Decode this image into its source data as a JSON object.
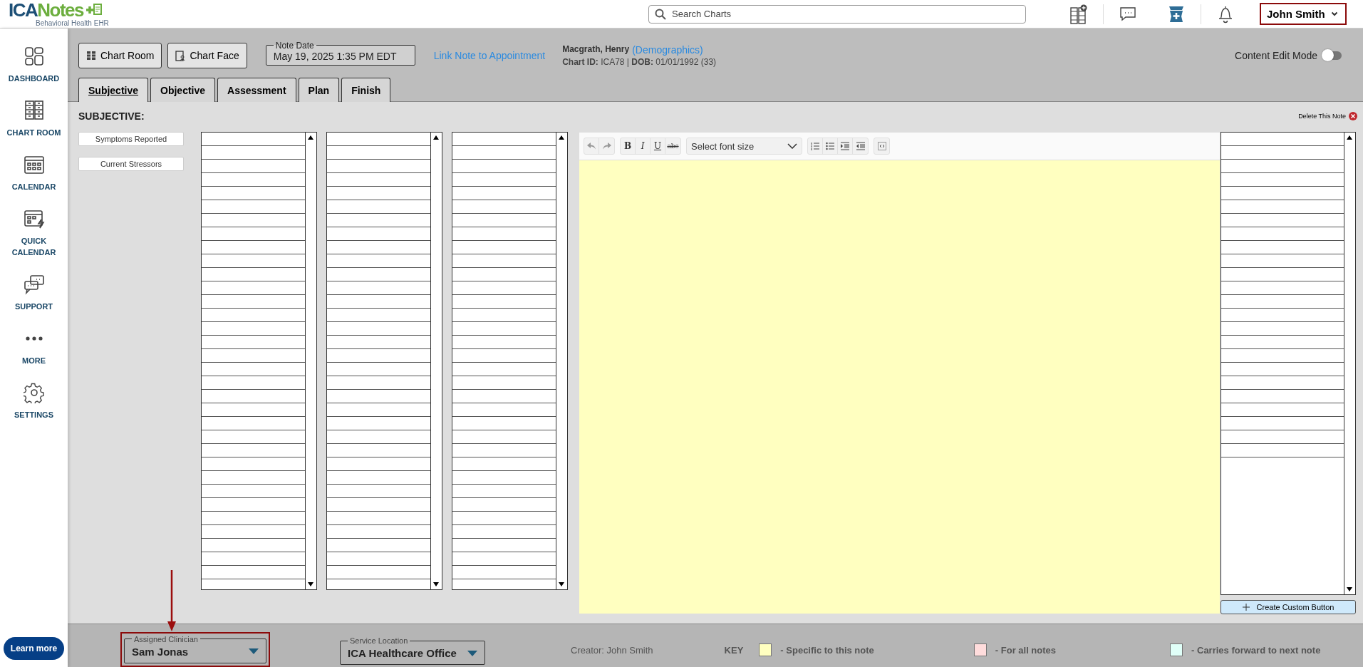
{
  "header": {
    "logo": {
      "part_a": "ICA",
      "part_b": "Notes",
      "subtitle": "Behavioral Health EHR"
    },
    "search": {
      "placeholder": "Search Charts"
    },
    "user": "John Smith"
  },
  "sidebar": {
    "items": [
      {
        "label": "DASHBOARD",
        "kind": "dashboard"
      },
      {
        "label": "CHART ROOM",
        "kind": "chartroom"
      },
      {
        "label": "CALENDAR",
        "kind": "calendar"
      },
      {
        "label": "QUICK CALENDAR",
        "kind": "quickcalendar"
      },
      {
        "label": "SUPPORT",
        "kind": "support"
      },
      {
        "label": "MORE",
        "kind": "more"
      },
      {
        "label": "SETTINGS",
        "kind": "settings"
      }
    ],
    "learn_more": "Learn more"
  },
  "note_header": {
    "buttons": [
      {
        "label": "Chart Room",
        "kind": "chartroom"
      },
      {
        "label": "Chart Face",
        "kind": "chartface"
      }
    ],
    "note_date": {
      "label": "Note Date",
      "value": "May 19, 2025 1:35 PM EDT"
    },
    "link": "Link Note to Appointment",
    "patient": {
      "name": "Macgrath, Henry",
      "demographics_link": "(Demographics)",
      "details": "**Chart ID:** ICA78 | **DOB:** 01/01/1992 (33)"
    },
    "content_edit_mode": {
      "label": "Content Edit Mode",
      "on": false
    }
  },
  "tabs": [
    {
      "label": "Subjective",
      "selected": true
    },
    {
      "label": "Objective",
      "selected": false
    },
    {
      "label": "Assessment",
      "selected": false
    },
    {
      "label": "Plan",
      "selected": false
    },
    {
      "label": "Finish",
      "selected": false
    }
  ],
  "section": {
    "title": "SUBJECTIVE:",
    "delete_note": "Delete This Note"
  },
  "quick_buttons": [
    "Symptoms Reported",
    "Current Stressors"
  ],
  "editor": {
    "format_buttons": [
      {
        "label": "B",
        "kind": "bold"
      },
      {
        "label": "I",
        "kind": "italic"
      },
      {
        "label": "U",
        "kind": "underline"
      },
      {
        "label": "abc",
        "kind": "strike"
      }
    ],
    "font_size": {
      "placeholder": "Select font size"
    }
  },
  "create_custom_button": "Create Custom Button",
  "footer": {
    "assigned_clinician": {
      "label": "Assigned Clinician",
      "value": "Sam Jonas"
    },
    "service_location": {
      "label": "Service Location",
      "value": "ICA Healthcare Office"
    },
    "creator": "Creator: John Smith",
    "key": {
      "label": "KEY",
      "items": [
        {
          "text": "- Specific to this note",
          "color": "#ffffc0"
        },
        {
          "text": "- For all notes",
          "color": "#ffdcdc"
        },
        {
          "text": "- Carries forward to next note",
          "color": "#e0fff8"
        }
      ]
    }
  }
}
